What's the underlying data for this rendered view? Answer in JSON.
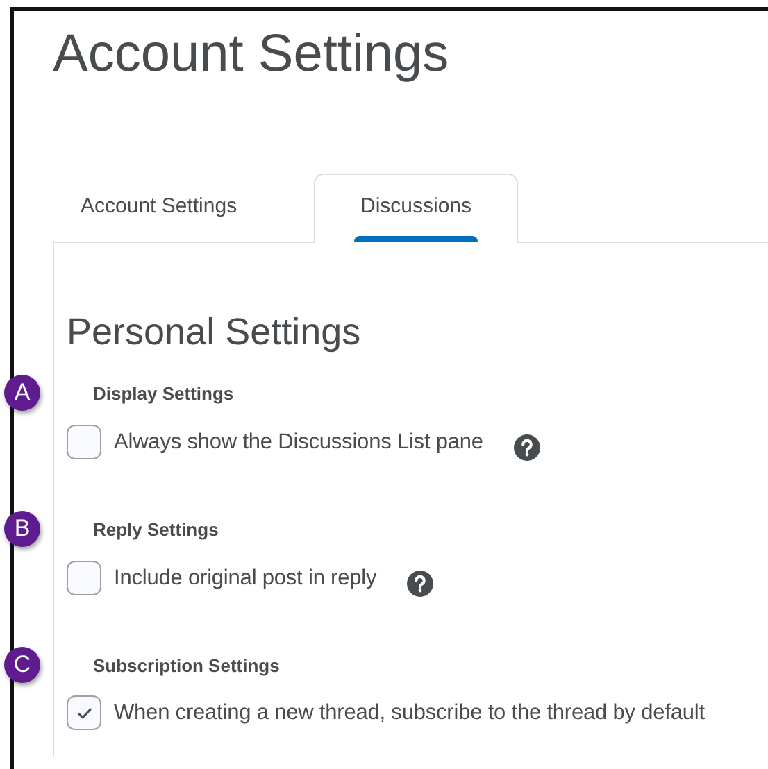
{
  "title": "Account Settings",
  "tabs": [
    {
      "label": "Account Settings",
      "selected": false
    },
    {
      "label": "Discussions",
      "selected": true
    }
  ],
  "section_title": "Personal Settings",
  "groups": [
    {
      "badge": "A",
      "heading": "Display Settings",
      "options": [
        {
          "label": "Always show the Discussions List pane",
          "checked": false,
          "help": true
        }
      ]
    },
    {
      "badge": "B",
      "heading": "Reply Settings",
      "options": [
        {
          "label": "Include original post in reply",
          "checked": false,
          "help": true
        }
      ]
    },
    {
      "badge": "C",
      "heading": "Subscription Settings",
      "options": [
        {
          "label": "When creating a new thread, subscribe to the thread by default",
          "checked": true,
          "help": false
        }
      ]
    }
  ]
}
